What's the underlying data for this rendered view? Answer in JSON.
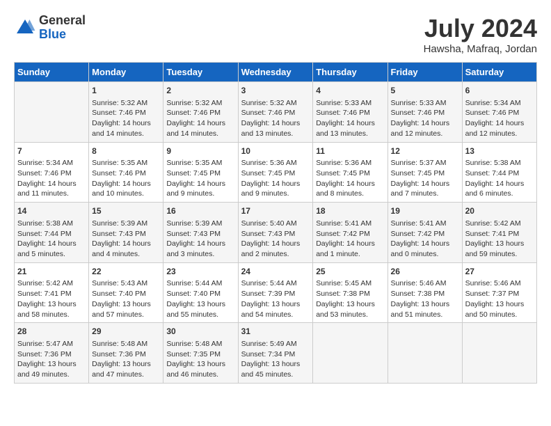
{
  "header": {
    "logo_general": "General",
    "logo_blue": "Blue",
    "month_title": "July 2024",
    "location": "Hawsha, Mafraq, Jordan"
  },
  "days_of_week": [
    "Sunday",
    "Monday",
    "Tuesday",
    "Wednesday",
    "Thursday",
    "Friday",
    "Saturday"
  ],
  "weeks": [
    [
      {
        "day": "",
        "content": ""
      },
      {
        "day": "1",
        "content": "Sunrise: 5:32 AM\nSunset: 7:46 PM\nDaylight: 14 hours\nand 14 minutes."
      },
      {
        "day": "2",
        "content": "Sunrise: 5:32 AM\nSunset: 7:46 PM\nDaylight: 14 hours\nand 14 minutes."
      },
      {
        "day": "3",
        "content": "Sunrise: 5:32 AM\nSunset: 7:46 PM\nDaylight: 14 hours\nand 13 minutes."
      },
      {
        "day": "4",
        "content": "Sunrise: 5:33 AM\nSunset: 7:46 PM\nDaylight: 14 hours\nand 13 minutes."
      },
      {
        "day": "5",
        "content": "Sunrise: 5:33 AM\nSunset: 7:46 PM\nDaylight: 14 hours\nand 12 minutes."
      },
      {
        "day": "6",
        "content": "Sunrise: 5:34 AM\nSunset: 7:46 PM\nDaylight: 14 hours\nand 12 minutes."
      }
    ],
    [
      {
        "day": "7",
        "content": "Sunrise: 5:34 AM\nSunset: 7:46 PM\nDaylight: 14 hours\nand 11 minutes."
      },
      {
        "day": "8",
        "content": "Sunrise: 5:35 AM\nSunset: 7:46 PM\nDaylight: 14 hours\nand 10 minutes."
      },
      {
        "day": "9",
        "content": "Sunrise: 5:35 AM\nSunset: 7:45 PM\nDaylight: 14 hours\nand 9 minutes."
      },
      {
        "day": "10",
        "content": "Sunrise: 5:36 AM\nSunset: 7:45 PM\nDaylight: 14 hours\nand 9 minutes."
      },
      {
        "day": "11",
        "content": "Sunrise: 5:36 AM\nSunset: 7:45 PM\nDaylight: 14 hours\nand 8 minutes."
      },
      {
        "day": "12",
        "content": "Sunrise: 5:37 AM\nSunset: 7:45 PM\nDaylight: 14 hours\nand 7 minutes."
      },
      {
        "day": "13",
        "content": "Sunrise: 5:38 AM\nSunset: 7:44 PM\nDaylight: 14 hours\nand 6 minutes."
      }
    ],
    [
      {
        "day": "14",
        "content": "Sunrise: 5:38 AM\nSunset: 7:44 PM\nDaylight: 14 hours\nand 5 minutes."
      },
      {
        "day": "15",
        "content": "Sunrise: 5:39 AM\nSunset: 7:43 PM\nDaylight: 14 hours\nand 4 minutes."
      },
      {
        "day": "16",
        "content": "Sunrise: 5:39 AM\nSunset: 7:43 PM\nDaylight: 14 hours\nand 3 minutes."
      },
      {
        "day": "17",
        "content": "Sunrise: 5:40 AM\nSunset: 7:43 PM\nDaylight: 14 hours\nand 2 minutes."
      },
      {
        "day": "18",
        "content": "Sunrise: 5:41 AM\nSunset: 7:42 PM\nDaylight: 14 hours\nand 1 minute."
      },
      {
        "day": "19",
        "content": "Sunrise: 5:41 AM\nSunset: 7:42 PM\nDaylight: 14 hours\nand 0 minutes."
      },
      {
        "day": "20",
        "content": "Sunrise: 5:42 AM\nSunset: 7:41 PM\nDaylight: 13 hours\nand 59 minutes."
      }
    ],
    [
      {
        "day": "21",
        "content": "Sunrise: 5:42 AM\nSunset: 7:41 PM\nDaylight: 13 hours\nand 58 minutes."
      },
      {
        "day": "22",
        "content": "Sunrise: 5:43 AM\nSunset: 7:40 PM\nDaylight: 13 hours\nand 57 minutes."
      },
      {
        "day": "23",
        "content": "Sunrise: 5:44 AM\nSunset: 7:40 PM\nDaylight: 13 hours\nand 55 minutes."
      },
      {
        "day": "24",
        "content": "Sunrise: 5:44 AM\nSunset: 7:39 PM\nDaylight: 13 hours\nand 54 minutes."
      },
      {
        "day": "25",
        "content": "Sunrise: 5:45 AM\nSunset: 7:38 PM\nDaylight: 13 hours\nand 53 minutes."
      },
      {
        "day": "26",
        "content": "Sunrise: 5:46 AM\nSunset: 7:38 PM\nDaylight: 13 hours\nand 51 minutes."
      },
      {
        "day": "27",
        "content": "Sunrise: 5:46 AM\nSunset: 7:37 PM\nDaylight: 13 hours\nand 50 minutes."
      }
    ],
    [
      {
        "day": "28",
        "content": "Sunrise: 5:47 AM\nSunset: 7:36 PM\nDaylight: 13 hours\nand 49 minutes."
      },
      {
        "day": "29",
        "content": "Sunrise: 5:48 AM\nSunset: 7:36 PM\nDaylight: 13 hours\nand 47 minutes."
      },
      {
        "day": "30",
        "content": "Sunrise: 5:48 AM\nSunset: 7:35 PM\nDaylight: 13 hours\nand 46 minutes."
      },
      {
        "day": "31",
        "content": "Sunrise: 5:49 AM\nSunset: 7:34 PM\nDaylight: 13 hours\nand 45 minutes."
      },
      {
        "day": "",
        "content": ""
      },
      {
        "day": "",
        "content": ""
      },
      {
        "day": "",
        "content": ""
      }
    ]
  ]
}
